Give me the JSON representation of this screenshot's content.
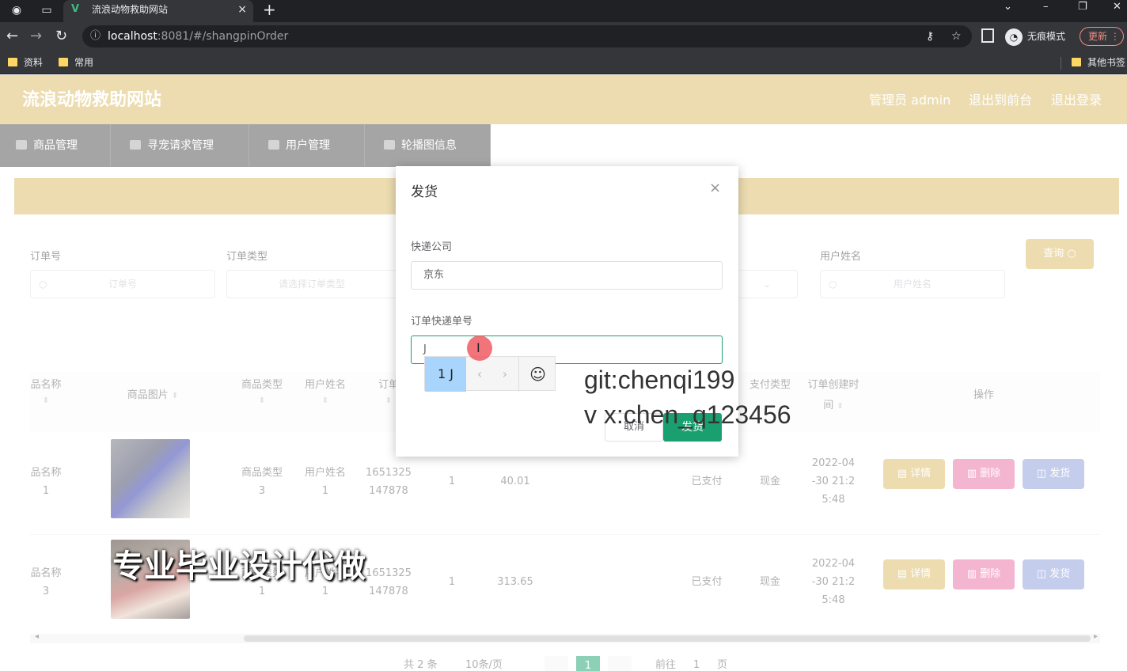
{
  "browser": {
    "tab_title": "流浪动物救助网站",
    "url_host": "localhost",
    "url_path": ":8081/#/shangpinOrder",
    "incognito_label": "无痕模式",
    "update_label": "更新",
    "bookmarks": [
      "资料",
      "常用"
    ],
    "other_bookmarks": "其他书签"
  },
  "header": {
    "title": "流浪动物救助网站",
    "admin": "管理员 admin",
    "exit_front": "退出到前台",
    "logout": "退出登录"
  },
  "menu": [
    "商品管理",
    "寻宠请求管理",
    "用户管理",
    "轮播图信息"
  ],
  "search": {
    "order_no_label": "订单号",
    "order_no_placeholder": "订单号",
    "order_type_label": "订单类型",
    "order_type_placeholder": "请选择订单类型",
    "user_name_label": "用户姓名",
    "user_name_placeholder": "用户姓名",
    "query_label": "查询"
  },
  "table": {
    "headers": [
      "品名称",
      "商品图片",
      "商品类型",
      "用户姓名",
      "订单",
      "支付类型",
      "订单创建时间",
      "操作"
    ],
    "rows": [
      {
        "name": "品名称\n1",
        "type": "商品类型\n3",
        "user": "用户姓名\n1",
        "order": "1651325\n147878",
        "qty": "1",
        "price": "40.01",
        "status": "已支付",
        "pay": "现金",
        "time": "2022-04\n-30 21:2\n5:48"
      },
      {
        "name": "品名称\n3",
        "type": "商品类型\n1",
        "user": "用户姓名\n1",
        "order": "1651325\n147878",
        "qty": "1",
        "price": "313.65",
        "status": "已支付",
        "pay": "现金",
        "time": "2022-04\n-30 21:2\n5:48"
      }
    ],
    "actions": {
      "detail": "详情",
      "delete": "删除",
      "ship": "发货"
    }
  },
  "pager": {
    "total": "共 2 条",
    "size": "10条/页",
    "current": "1",
    "goto": "前往",
    "goto_val": "1",
    "page": "页"
  },
  "dialog": {
    "title": "发货",
    "courier_label": "快递公司",
    "courier_value": "京东",
    "tracking_label": "订单快递单号",
    "tracking_value": "J",
    "cancel": "取消",
    "confirm": "发货"
  },
  "ime": {
    "candidate": "1 J"
  },
  "watermarks": [
    "git:chenqi199",
    "v x:chen_q123456",
    "专业毕业设计代做"
  ]
}
